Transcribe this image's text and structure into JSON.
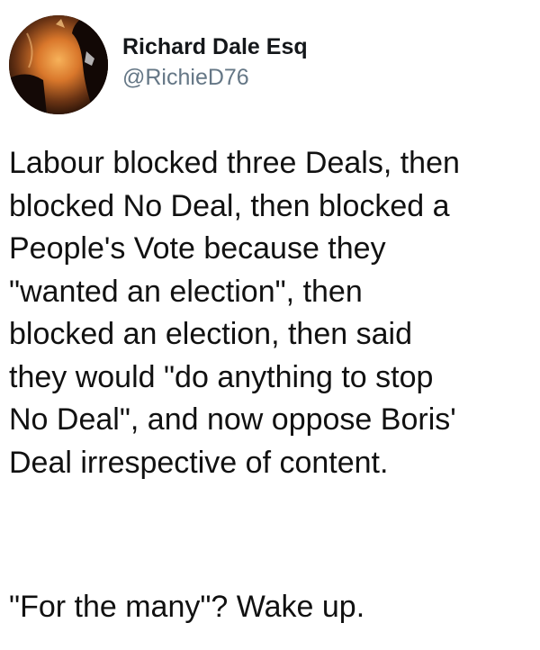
{
  "tweet": {
    "author": {
      "display_name": "Richard Dale Esq",
      "handle": "@RichieD76",
      "avatar_icon": "avatar-photo"
    },
    "body_lines": [
      "Labour blocked three Deals, then",
      "blocked No Deal, then blocked a",
      "People's Vote because they",
      "\"wanted an election\", then",
      "blocked an election, then said",
      "they would \"do anything to stop",
      "No Deal\", and now oppose Boris'",
      "Deal irrespective of content."
    ],
    "closing_line": "\"For the many\"? Wake up."
  },
  "colors": {
    "background": "#ffffff",
    "text": "#111111",
    "handle": "#657786"
  }
}
